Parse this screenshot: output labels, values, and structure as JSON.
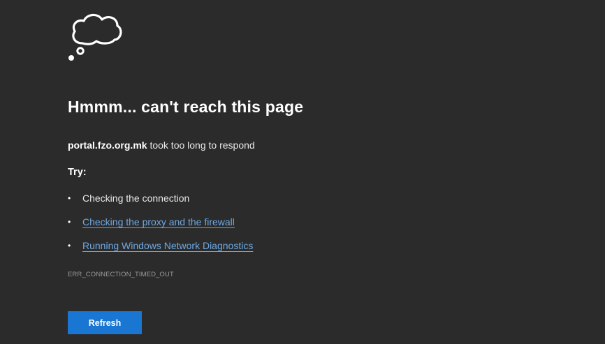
{
  "icon": "thought-cloud-icon",
  "heading": "Hmmm... can't reach this page",
  "message": {
    "host": "portal.fzo.org.mk",
    "text": " took too long to respond"
  },
  "try_label": "Try:",
  "suggestions": [
    {
      "label": "Checking the connection",
      "is_link": false
    },
    {
      "label": "Checking the proxy and the firewall",
      "is_link": true
    },
    {
      "label": "Running Windows Network Diagnostics",
      "is_link": true
    }
  ],
  "bullet": "•",
  "error_code": "ERR_CONNECTION_TIMED_OUT",
  "refresh_label": "Refresh",
  "colors": {
    "background": "#2b2b2b",
    "link": "#6ea8e0",
    "button": "#1976d2"
  }
}
